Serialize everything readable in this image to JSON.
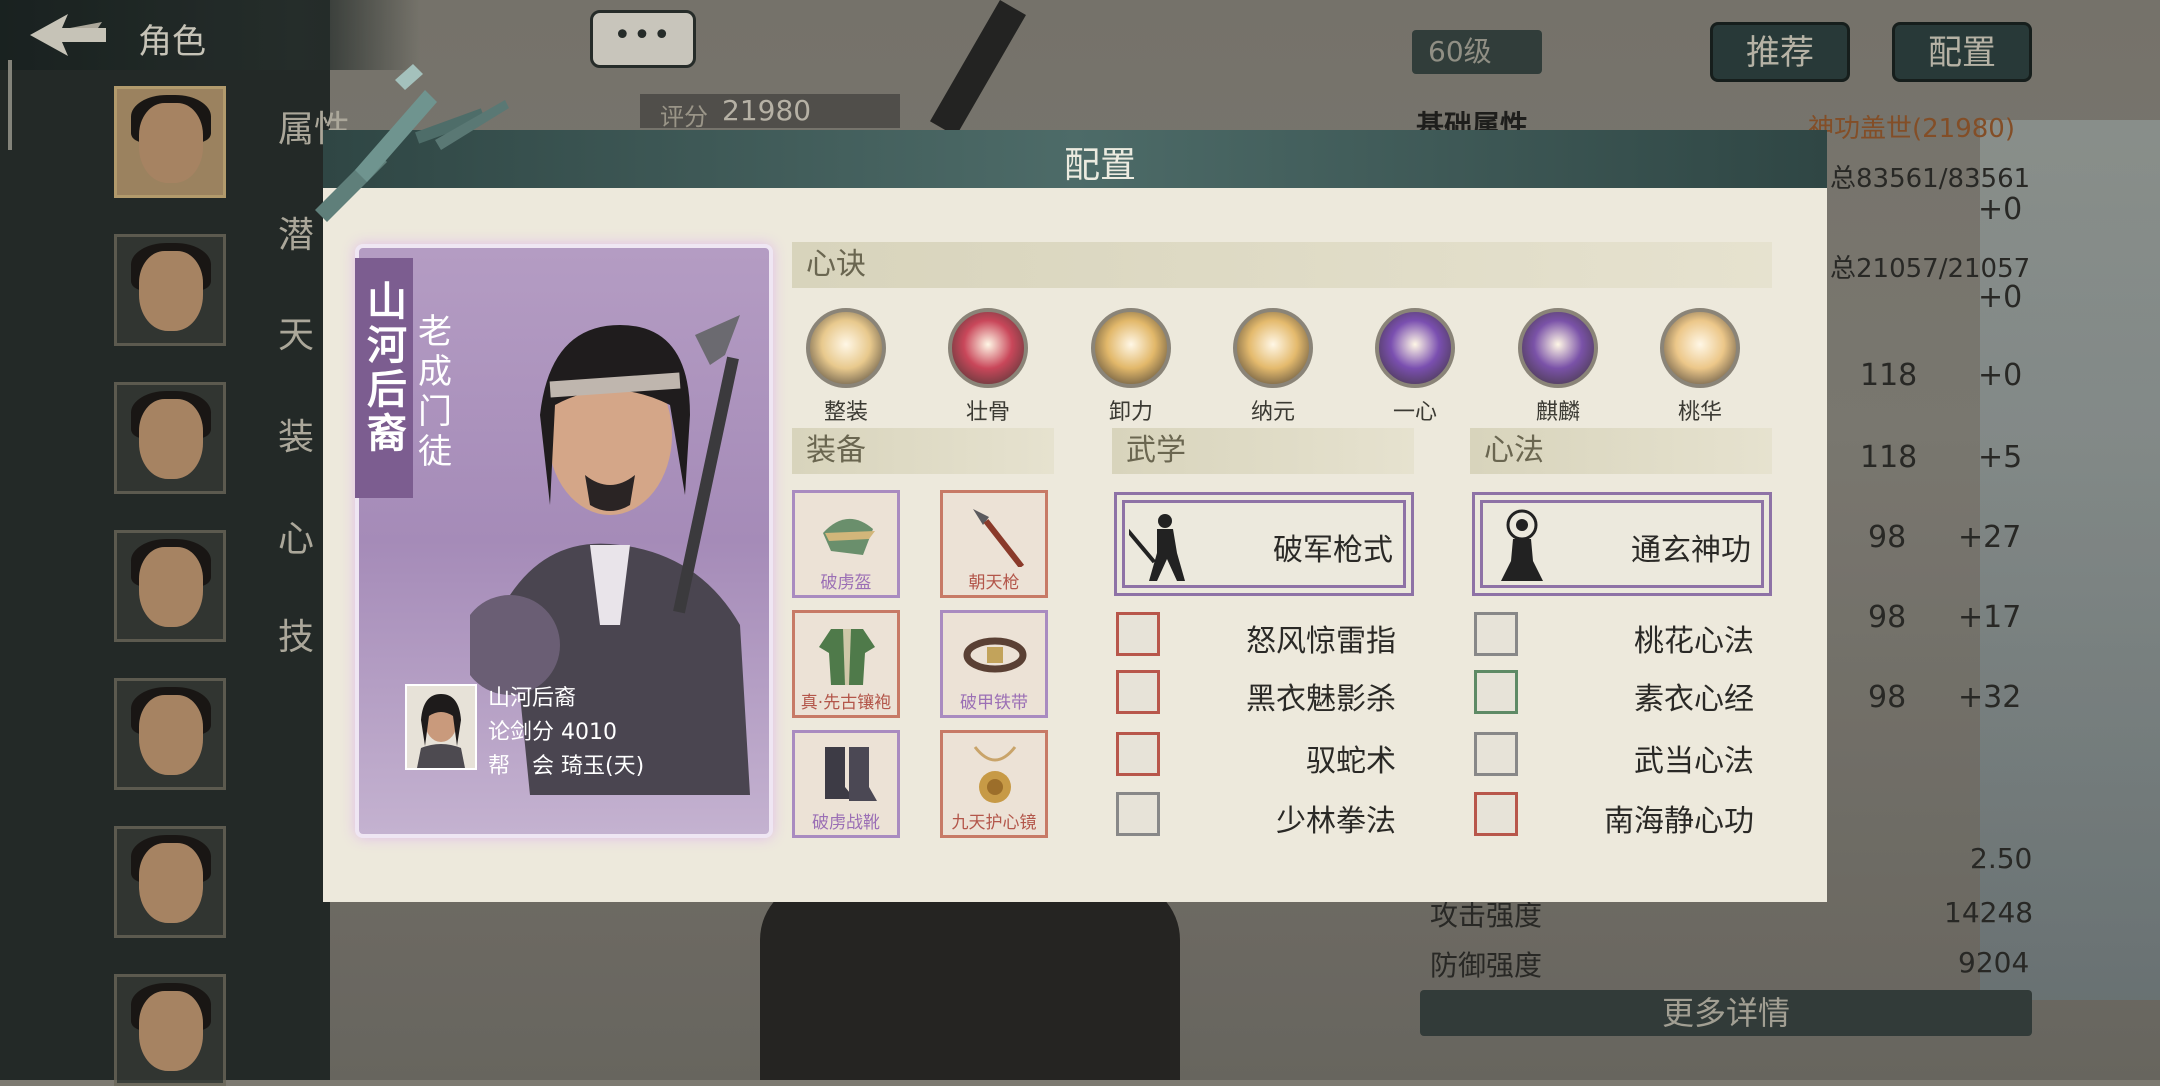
{
  "header": {
    "title": "角色"
  },
  "bubble": {
    "text": "•••"
  },
  "score": {
    "label": "评分",
    "value": "21980"
  },
  "left_tabs": [
    "属性",
    "潜",
    "天",
    "装",
    "心",
    "技"
  ],
  "level": "60级",
  "top_buttons": {
    "recommend": "推荐",
    "config": "配置"
  },
  "attributes": {
    "title": "基础属性",
    "power": "神功盖世(21980)",
    "hp": "总83561/83561",
    "hp_bonus": "+0",
    "mp": "总21057/21057",
    "mp_bonus": "+0",
    "rows": [
      {
        "value": "118",
        "bonus": "+0"
      },
      {
        "value": "118",
        "bonus": "+5"
      },
      {
        "value": "98",
        "bonus": "+27"
      },
      {
        "value": "98",
        "bonus": "+17"
      },
      {
        "value": "98",
        "bonus": "+32"
      }
    ],
    "extra_value": "2.50",
    "attack_label": "攻击强度",
    "attack_value": "14248",
    "defense_label": "防御强度",
    "defense_value": "9204",
    "more_label": "更多详情"
  },
  "modal": {
    "title": "配置",
    "card": {
      "name": "山河后裔",
      "sect": "老成门徒",
      "info_name": "山河后裔",
      "info_score": "论剑分 4010",
      "info_guild": "帮　会 琦玉(天)"
    },
    "xinjue_title": "心诀",
    "xinjue": [
      {
        "label": "整装",
        "color": "#e8c98d"
      },
      {
        "label": "壮骨",
        "color": "#c9475a"
      },
      {
        "label": "卸力",
        "color": "#e2b86a"
      },
      {
        "label": "纳元",
        "color": "#e4ba6d"
      },
      {
        "label": "一心",
        "color": "#7a4fb0"
      },
      {
        "label": "麒麟",
        "color": "#7a52a8"
      },
      {
        "label": "桃华",
        "color": "#ecc789"
      }
    ],
    "equip_title": "装备",
    "equipment": [
      {
        "label": "破虏盔",
        "tier": "purple"
      },
      {
        "label": "朝天枪",
        "tier": "red"
      },
      {
        "label": "真·先古镶袍",
        "tier": "red"
      },
      {
        "label": "破甲铁带",
        "tier": "purple"
      },
      {
        "label": "破虏战靴",
        "tier": "purple"
      },
      {
        "label": "九天护心镜",
        "tier": "red"
      }
    ],
    "wuxue_title": "武学",
    "wuxue_main": "破军枪式",
    "wuxue_list": [
      "怒风惊雷指",
      "黑衣魅影杀",
      "驭蛇术",
      "少林拳法"
    ],
    "xinfa_title": "心法",
    "xinfa_main": "通玄神功",
    "xinfa_list": [
      "桃花心法",
      "素衣心经",
      "武当心法",
      "南海静心功"
    ]
  }
}
